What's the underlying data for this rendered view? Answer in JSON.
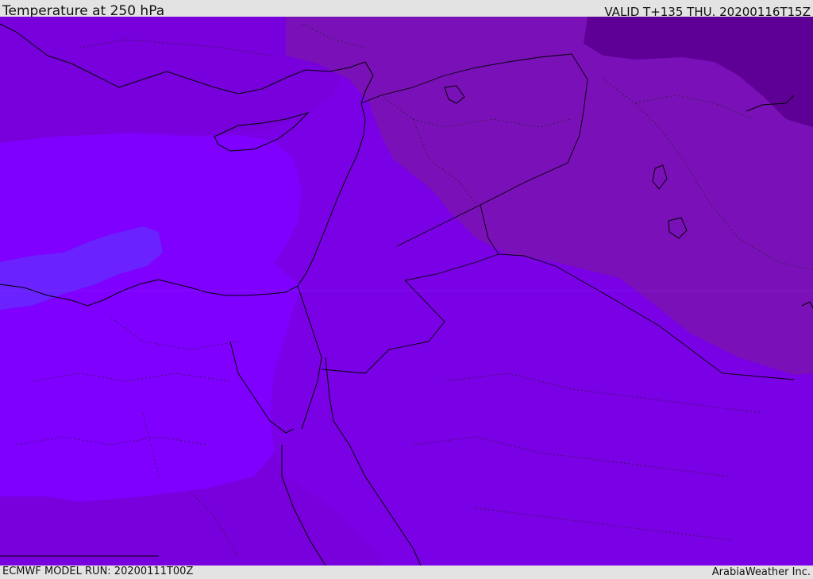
{
  "header": {
    "title": "Temperature at 250 hPa",
    "valid_time": "VALID T+135 THU. 20200116T15Z"
  },
  "footer": {
    "model_run": "ECMWF MODEL RUN: 20200111T00Z",
    "credit": "ArabiaWeather Inc."
  },
  "map": {
    "field": "temperature",
    "level": "250 hPa",
    "colors": {
      "coldest_band": "#5e0096",
      "cold_band": "#7a10b8",
      "mid_band": "#7800dc",
      "main_band": "#7a00e6",
      "warm_band": "#7f00ff",
      "warmest_band": "#6a22ff",
      "coastline": "#000000",
      "border": "#000000"
    }
  }
}
